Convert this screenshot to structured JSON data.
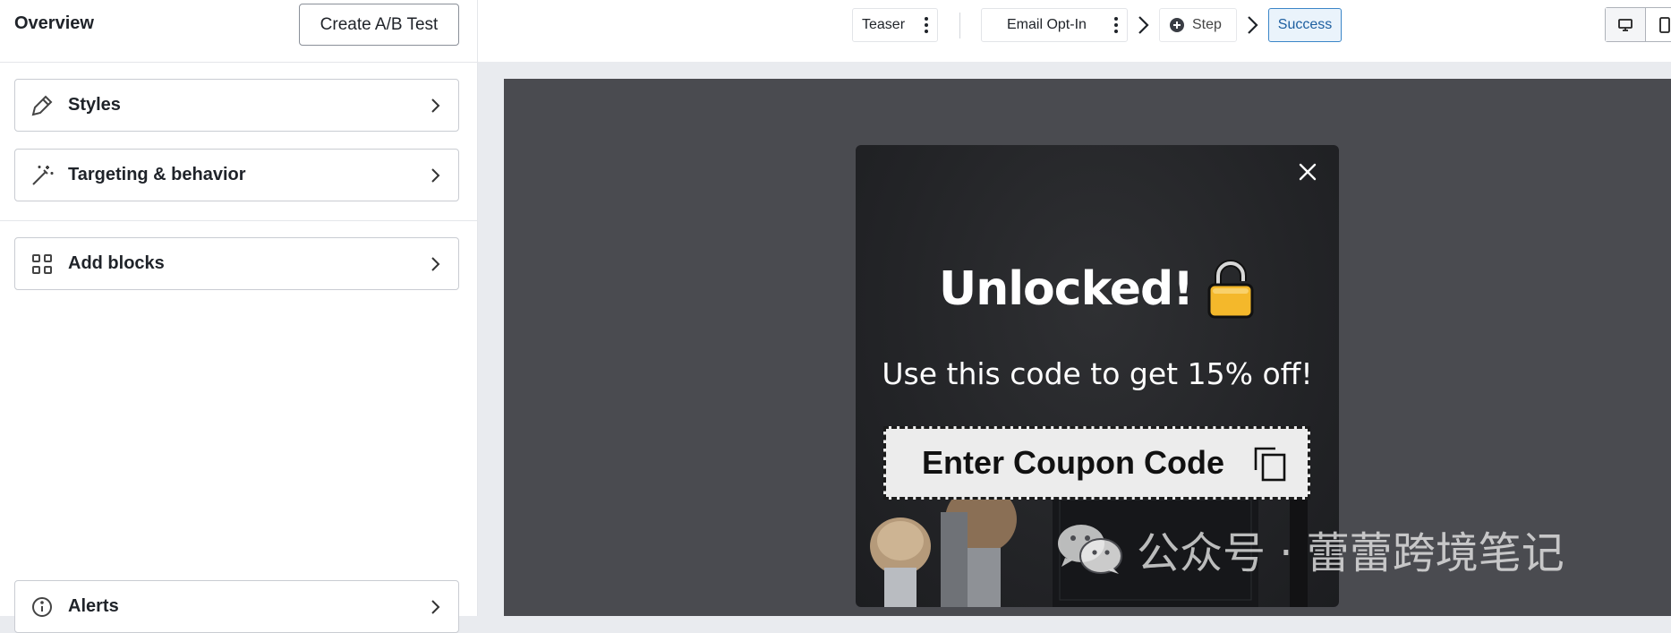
{
  "sidebar": {
    "title": "Overview",
    "ab_button": "Create A/B Test",
    "panels": [
      {
        "label": "Styles",
        "icon": "pencil-icon"
      },
      {
        "label": "Targeting & behavior",
        "icon": "magic-wand-icon"
      },
      {
        "label": "Add blocks",
        "icon": "blocks-grid-icon"
      },
      {
        "label": "Alerts",
        "icon": "info-icon"
      }
    ]
  },
  "topbar": {
    "steps": [
      {
        "label": "Teaser"
      },
      {
        "label": "Email Opt-In"
      },
      {
        "label": "Step"
      }
    ],
    "success": "Success",
    "devices": [
      "desktop-icon",
      "mobile-icon"
    ]
  },
  "popup": {
    "headline": "Unlocked!",
    "subline": "Use this code to get 15% off!",
    "coupon_text": "Enter Coupon Code"
  },
  "watermark": {
    "text": "公众号 · 蕾蕾跨境笔记"
  },
  "colors": {
    "accent": "#3b86c8",
    "canvas": "#4a4b50",
    "popup_bg": "#232427"
  }
}
